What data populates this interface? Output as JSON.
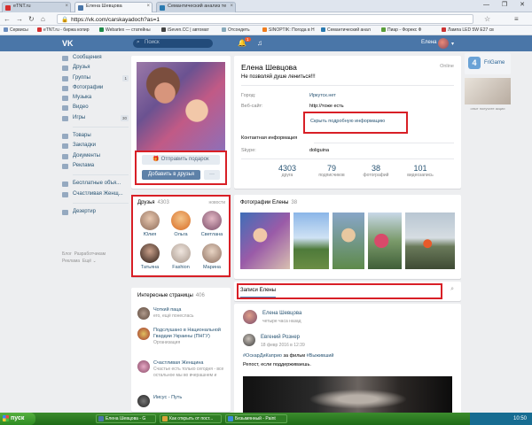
{
  "browser": {
    "tabs": [
      {
        "label": "eTNT.ru",
        "color": "#d62f2f"
      },
      {
        "label": "Елена Шевцова",
        "color": "#4a76a8"
      },
      {
        "label": "Семантический анализ те",
        "color": "#2a7ab0"
      }
    ],
    "window_controls": "— ❐ ✕",
    "url": "https://vk.com/carskayadoch?as=1",
    "bookmarks": [
      {
        "label": "Сервисы",
        "color": "#6c8ebf"
      },
      {
        "label": "eTNT.ru - биржа копир",
        "color": "#d62f2f"
      },
      {
        "label": "Webartex — статейны",
        "color": "#1f8a4a"
      },
      {
        "label": "iSeven.CC | автомат",
        "color": "#444"
      },
      {
        "label": "Отсоедеть",
        "color": "#8ab"
      },
      {
        "label": "SINOPTIK: Погода в Н",
        "color": "#f07c1d"
      },
      {
        "label": "Семантический анал",
        "color": "#2a7ab0"
      },
      {
        "label": "Пиар - Форекс Ф",
        "color": "#5a9e3a"
      },
      {
        "label": "Лампа LED 5W E27 св",
        "color": "#c33"
      }
    ]
  },
  "vk_header": {
    "logo": "VK",
    "search_placeholder": "Поиск",
    "notifications_badge": "1",
    "user_name": "Елена",
    "accent": "#4a76a8"
  },
  "left_menu": {
    "items": [
      {
        "label": "Сообщения",
        "count": ""
      },
      {
        "label": "Друзья",
        "count": ""
      },
      {
        "label": "Группы",
        "count": "1"
      },
      {
        "label": "Фотографии",
        "count": ""
      },
      {
        "label": "Музыка",
        "count": ""
      },
      {
        "label": "Видео",
        "count": ""
      },
      {
        "label": "Игры",
        "count": "30"
      }
    ],
    "items2": [
      "Товары",
      "Закладки",
      "Документы",
      "Реклама"
    ],
    "items3": [
      "Бесплатные объя...",
      "Счастливая Женщ..."
    ],
    "items4": [
      "Дезертир"
    ],
    "footer": [
      "Блог",
      "Разработчикам",
      "Реклама",
      "Ещё ⌄"
    ]
  },
  "profile_actions": {
    "gift_button": "Отправить подарок",
    "add_friend_button": "Добавить в друзья",
    "more_button": "···"
  },
  "friends": {
    "title": "Друзья",
    "count": "4303",
    "news_link": "новости",
    "list": [
      {
        "name": "Юлия",
        "color": "#c9a890"
      },
      {
        "name": "Ольга",
        "color": "#e0762a"
      },
      {
        "name": "Светлана",
        "color": "#a36c8a"
      },
      {
        "name": "Татьяна",
        "color": "#3b2a24"
      },
      {
        "name": "Fashion",
        "color": "#c4b8b0"
      },
      {
        "name": "Марина",
        "color": "#b79d8a"
      }
    ]
  },
  "interesting_pages": {
    "title": "Интересные страницы",
    "count": "406",
    "list": [
      {
        "name": "Чоткий паца",
        "sub": "его, ещё понеслась",
        "color": "#7b6a5e"
      },
      {
        "name": "Подслушано в Национальной Гвардии Украины (ПНГУ)",
        "sub": "Организация",
        "color": "#a2382c"
      },
      {
        "name": "Счастливая Женщина",
        "sub": "Счастье есть только сегодня - все остальное мы во вчерашнем и",
        "color": "#8a4a68"
      },
      {
        "name": "Иисус - Путь",
        "sub": "",
        "color": "#2e2e2e"
      }
    ]
  },
  "profile": {
    "name": "Елена Шевцова",
    "online": "Online",
    "status": "Не позволяй душе лениться!!!",
    "rows": [
      {
        "label": "Город:",
        "value": "Иркутск.нет"
      },
      {
        "label": "Веб-сайт:",
        "value": "http://тоже есть"
      }
    ],
    "more_info": "Скрыть подробную информацию",
    "contacts_header": "Контактная информация",
    "skype_label": "Skype:",
    "skype_value": "doliguina",
    "stats": [
      {
        "num": "4303",
        "label": "друга"
      },
      {
        "num": "79",
        "label": "подписчиков"
      },
      {
        "num": "38",
        "label": "фотографий"
      },
      {
        "num": "101",
        "label": "видеозапись"
      }
    ]
  },
  "photos": {
    "title": "Фотографии Елены",
    "count": "38"
  },
  "wall": {
    "title": "Записи Елены"
  },
  "post": {
    "author": "Елена Шевцова",
    "date": "четыре часа назад",
    "repost_author": "Евгений Рознер",
    "repost_date": "18 февр 2016 в 12:39",
    "hashtags": "#ОскарДиКаприо",
    "text_mid": " за фильм ",
    "hashtag2": "#Выживший",
    "text2": "Репост, если поддерживаешь."
  },
  "right_ads": {
    "title": "FriGame",
    "caption": "опыт получите акции"
  },
  "taskbar": {
    "start": "пуск",
    "items": [
      {
        "label": "Елена Шевцова - G",
        "color": "#4a76a8"
      },
      {
        "label": "Как открыть от пост...",
        "color": "#d9a23a"
      },
      {
        "label": "Безымянный - Paint",
        "color": "#3a8cd9"
      }
    ],
    "clock": "10:50"
  }
}
